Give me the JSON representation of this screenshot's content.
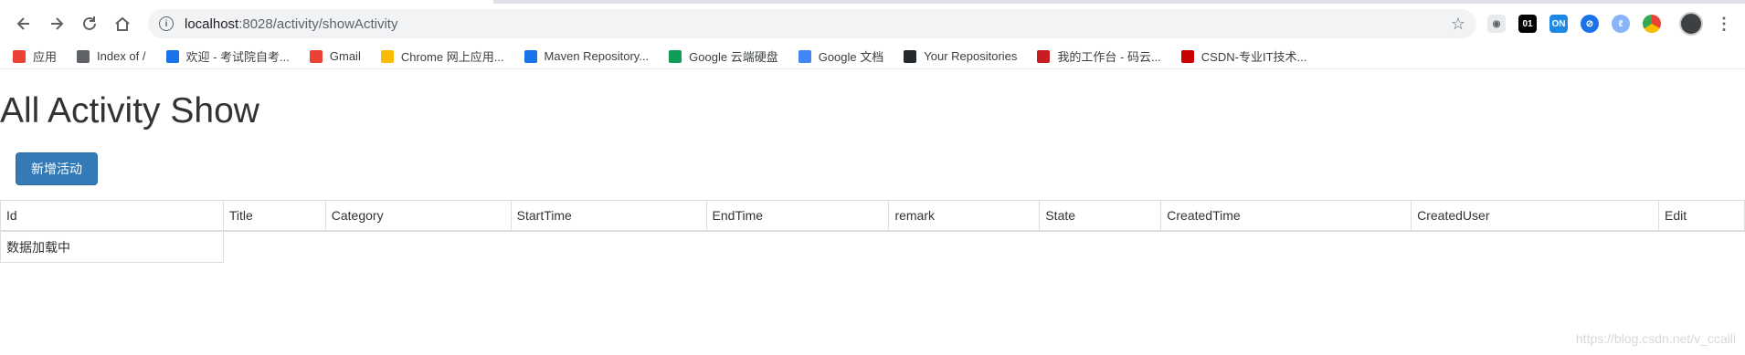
{
  "browser": {
    "url_host": "localhost",
    "url_path": ":8028/activity/showActivity"
  },
  "bookmarks": [
    {
      "label": "应用",
      "icon": "apps-grid-icon",
      "color": "#ea4335"
    },
    {
      "label": "Index of /",
      "icon": "globe-icon",
      "color": "#5f6368"
    },
    {
      "label": "欢迎 - 考试院自考...",
      "icon": "site-icon",
      "color": "#1a73e8"
    },
    {
      "label": "Gmail",
      "icon": "gmail-icon",
      "color": "#ea4335"
    },
    {
      "label": "Chrome 网上应用...",
      "icon": "chrome-webstore-icon",
      "color": "#fbbc04"
    },
    {
      "label": "Maven Repository...",
      "icon": "maven-icon",
      "color": "#1a73e8"
    },
    {
      "label": "Google 云端硬盘",
      "icon": "google-drive-icon",
      "color": "#0f9d58"
    },
    {
      "label": "Google 文档",
      "icon": "google-docs-icon",
      "color": "#4285f4"
    },
    {
      "label": "Your Repositories",
      "icon": "github-icon",
      "color": "#24292e"
    },
    {
      "label": "我的工作台 - 码云...",
      "icon": "gitee-icon",
      "color": "#c71d23"
    },
    {
      "label": "CSDN-专业IT技术...",
      "icon": "csdn-icon",
      "color": "#c90000"
    }
  ],
  "page": {
    "title": "All Activity Show",
    "add_button": "新增活动",
    "columns": [
      "Id",
      "Title",
      "Category",
      "StartTime",
      "EndTime",
      "remark",
      "State",
      "CreatedTime",
      "CreatedUser",
      "Edit"
    ],
    "loading_text": "数据加载中"
  },
  "watermark": "https://blog.csdn.net/v_ccaili"
}
